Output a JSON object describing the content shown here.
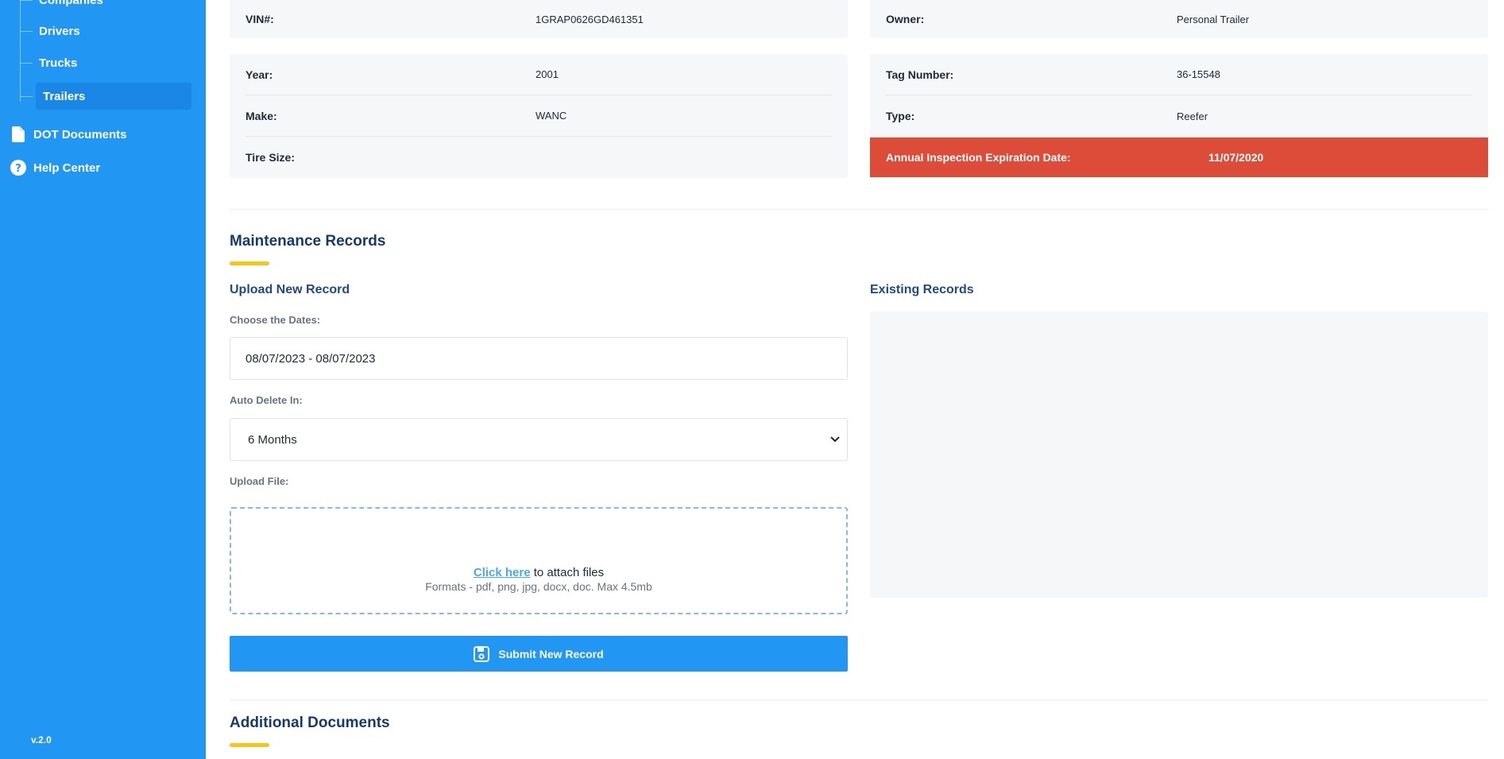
{
  "sidebar": {
    "sub_items": [
      {
        "label": "Companies"
      },
      {
        "label": "Drivers"
      },
      {
        "label": "Trucks"
      },
      {
        "label": "Trailers",
        "active": true
      }
    ],
    "nav": [
      {
        "label": "DOT Documents",
        "icon": "document-icon"
      },
      {
        "label": "Help Center",
        "icon": "question-circle-icon"
      }
    ],
    "version": "v.2.0"
  },
  "trailer_info": {
    "vin_label": "VIN#:",
    "vin": "1GRAP0626GD461351",
    "owner_label": "Owner:",
    "owner": "Personal Trailer",
    "year_label": "Year:",
    "year": "2001",
    "tag_label": "Tag Number:",
    "tag": "36-15548",
    "make_label": "Make:",
    "make": "WANC",
    "type_label": "Type:",
    "type": "Reefer",
    "tire_label": "Tire Size:",
    "tire": "",
    "inspection_label": "Annual Inspection Expiration Date:",
    "inspection": "11/07/2020"
  },
  "maintenance": {
    "title": "Maintenance Records",
    "upload_title": "Upload New Record",
    "dates_label": "Choose the Dates:",
    "dates_value": "08/07/2023 - 08/07/2023",
    "auto_delete_label": "Auto Delete In:",
    "auto_delete_value": "6 Months",
    "upload_label": "Upload File:",
    "click_here": "Click here",
    "attach_text": " to attach files",
    "formats": "Formats - pdf, png, jpg, docx, doc. Max 4.5mb",
    "submit_label": "Submit New Record",
    "existing_title": "Existing Records"
  },
  "additional": {
    "title": "Additional Documents"
  },
  "colors": {
    "sidebar": "#2196f3",
    "alert": "#dd4b39",
    "accent_underline": "#f5c518",
    "title": "#163a6b"
  }
}
